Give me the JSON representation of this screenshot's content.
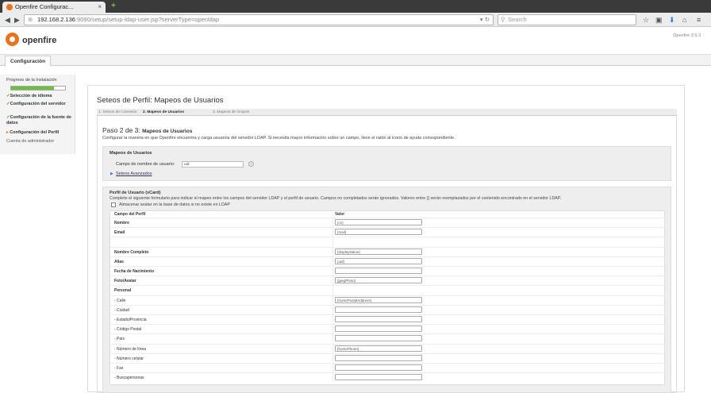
{
  "browser": {
    "tab_title": "Openfire Configurac...",
    "tab_close": "×",
    "new_tab": "+",
    "url_host": "192.168.2.136",
    "url_rest": ":9090/setup/setup-ldap-user.jsp?serverType=openldap",
    "search_placeholder": "Search"
  },
  "header": {
    "logo_text": "openfire",
    "version": "Openfire 3.9.3"
  },
  "topnav": {
    "item": "Configuración"
  },
  "sidebar": {
    "title": "Progreso de la Instalación",
    "progress": 0.8,
    "items": [
      {
        "label": "Selección de idioma",
        "status": "done"
      },
      {
        "label": "Configuración del servidor",
        "status": "done"
      },
      {
        "label": "Configuración de la fuente de datos",
        "status": "done"
      },
      {
        "label": "Configuración del Perfil",
        "status": "current"
      },
      {
        "label": "Cuenta de administrador",
        "status": "pending"
      }
    ]
  },
  "main": {
    "title": "Seteos de Perfil: Mapeos de Usuarios",
    "subtabs": [
      "1. Seteos de Conexión",
      "2. Mapeos de Usuarios",
      "3. Mapeos de Grupos"
    ],
    "step_prefix": "Paso 2 de 3:",
    "step_title": "Mapeos de Usuarios",
    "description": "Configurar la manera en que Openfire encuentra y carga usuarios del servidor LDAP. Si necesita mayor información sobre un campo, lleve el ratón al icono de ayuda correspondiente.",
    "mapping_box": {
      "title": "Mapeos de Usuarios",
      "field_label": "Campo de nombre de usuario:",
      "field_value": "uid",
      "help": "?",
      "advanced_link": "Seteos Avanzados"
    },
    "vcard": {
      "title": "Perfil de Usuario (vCard)",
      "description": "Complete el siguiente formulario para indicar el mapeo entre los campos del servidor LDAP y el perfil de usuario. Campos no completados serán ignorados. Valores entre {} serán reemplazados por el contenido encontrado en el servidor LDAP.",
      "checkbox_label": "Almacenar avatar en la base de datos si no existe en LDAP",
      "col_field": "Campo del Perfil",
      "col_value": "Valor",
      "rows": [
        {
          "label": "Nombre",
          "value": "{cn}",
          "bold": true,
          "input": true
        },
        {
          "label": "Email",
          "value": "{mail}",
          "bold": true,
          "input": true
        },
        {
          "label": "",
          "value": "",
          "bold": false,
          "input": false
        },
        {
          "label": "Nombre Completo",
          "value": "{displayName}",
          "bold": true,
          "input": true
        },
        {
          "label": "Alias",
          "value": "{uid}",
          "bold": true,
          "input": true
        },
        {
          "label": "Fecha de Nacimiento",
          "value": "",
          "bold": true,
          "input": true
        },
        {
          "label": "Foto/Avatar",
          "value": "{jpegPhoto}",
          "bold": true,
          "input": true
        },
        {
          "label": "Personal",
          "value": "",
          "bold": true,
          "input": false
        },
        {
          "label": "- Calle",
          "value": "{homePostalAddress}",
          "bold": false,
          "input": true
        },
        {
          "label": "- Ciudad",
          "value": "",
          "bold": false,
          "input": true
        },
        {
          "label": "- Estado/Provincia",
          "value": "",
          "bold": false,
          "input": true
        },
        {
          "label": "- Código Postal",
          "value": "",
          "bold": false,
          "input": true
        },
        {
          "label": "- País",
          "value": "",
          "bold": false,
          "input": true
        },
        {
          "label": "- Número de línea",
          "value": "{homePhone}",
          "bold": false,
          "input": true
        },
        {
          "label": "- Número celular",
          "value": "",
          "bold": false,
          "input": true
        },
        {
          "label": "- Fax",
          "value": "",
          "bold": false,
          "input": true
        },
        {
          "label": "- Buscapersonas",
          "value": "",
          "bold": false,
          "input": true
        }
      ]
    }
  }
}
